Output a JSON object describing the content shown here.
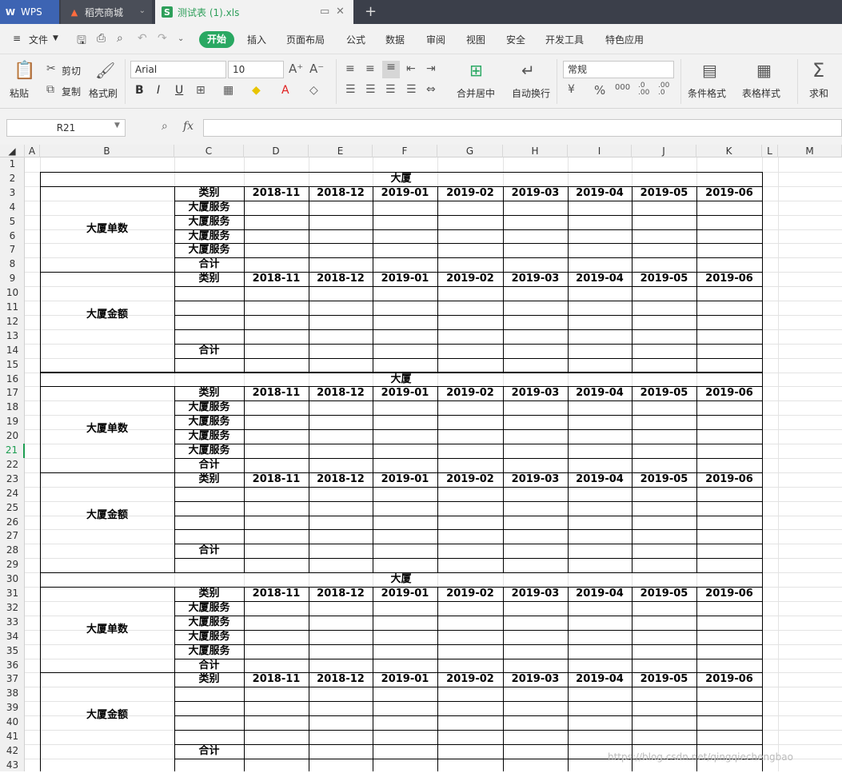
{
  "tabs": {
    "wps": "WPS",
    "store": "稻壳商城",
    "file": "测试表 (1).xls",
    "add": "+"
  },
  "menu": {
    "file": "文件",
    "items": [
      "开始",
      "插入",
      "页面布局",
      "公式",
      "数据",
      "审阅",
      "视图",
      "安全",
      "开发工具",
      "特色应用"
    ]
  },
  "toolbar": {
    "paste": "粘贴",
    "cut": "剪切",
    "copy": "复制",
    "format_painter": "格式刷",
    "font_name": "Arial",
    "font_size": "10",
    "font_grow": "A⁺",
    "font_shrink": "A⁻",
    "bold": "B",
    "italic": "I",
    "underline": "U",
    "merge_center": "合并居中",
    "wrap_text": "自动换行",
    "number_format": "常规",
    "percent": "%",
    "thousands": "000",
    "dec_inc": ".0\n.00",
    "dec_dec": ".00\n.0",
    "cond_format": "条件格式",
    "table_style": "表格样式",
    "sum": "求和"
  },
  "formula_bar": {
    "name_box": "R21",
    "fx": "fx",
    "value": ""
  },
  "columns": [
    "A",
    "B",
    "C",
    "D",
    "E",
    "F",
    "G",
    "H",
    "I",
    "J",
    "K",
    "L",
    "M"
  ],
  "rows": [
    "1",
    "2",
    "3",
    "4",
    "5",
    "6",
    "7",
    "8",
    "9",
    "10",
    "11",
    "12",
    "13",
    "14",
    "15",
    "16",
    "17",
    "18",
    "19",
    "20",
    "21",
    "22",
    "23",
    "24",
    "25",
    "26",
    "27",
    "28",
    "29",
    "30",
    "31",
    "32",
    "33",
    "34",
    "35",
    "36",
    "37",
    "38",
    "39",
    "40",
    "41",
    "42",
    "43"
  ],
  "selected_row": "21",
  "sheet": {
    "title": "大厦",
    "section_count": "大厦单数",
    "section_amount": "大厦金额",
    "category": "类别",
    "service": "大厦服务",
    "total": "合计",
    "months": [
      "2018-11",
      "2018-12",
      "2019-01",
      "2019-02",
      "2019-03",
      "2019-04",
      "2019-05",
      "2019-06"
    ]
  },
  "watermark": "https://blog.csdn.net/qingqiechengbao",
  "colors": {
    "accent_green": "#29a862",
    "tab_blue": "#3d64b3",
    "tabbar_bg": "#3b3f4a"
  }
}
